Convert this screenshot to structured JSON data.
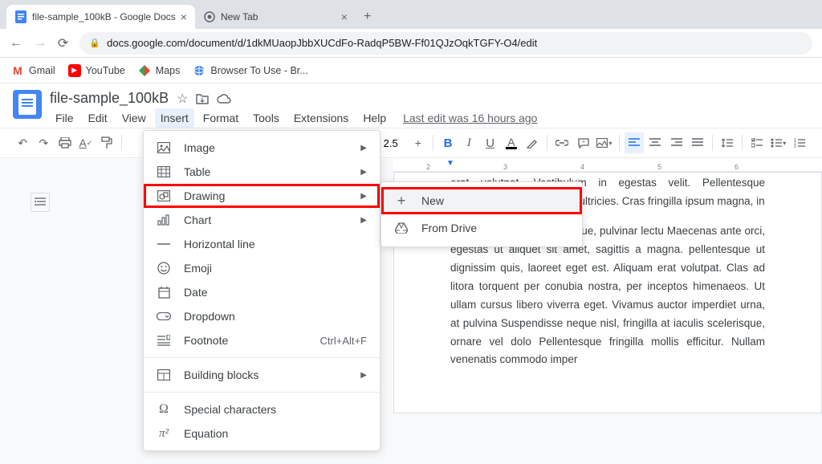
{
  "browser": {
    "tabs": [
      {
        "title": "file-sample_100kB - Google Docs",
        "active": true
      },
      {
        "title": "New Tab",
        "active": false
      }
    ],
    "url": "docs.google.com/document/d/1dkMUaopJbbXUCdFo-RadqP5BW-Ff01QJzOqkTGFY-O4/edit",
    "bookmarks": [
      {
        "label": "Gmail"
      },
      {
        "label": "YouTube"
      },
      {
        "label": "Maps"
      },
      {
        "label": "Browser To Use - Br..."
      }
    ]
  },
  "doc": {
    "title": "file-sample_100kB",
    "menus": [
      "File",
      "Edit",
      "View",
      "Insert",
      "Format",
      "Tools",
      "Extensions",
      "Help"
    ],
    "active_menu": "Insert",
    "last_edit": "Last edit was 16 hours ago",
    "font_size": "2.5"
  },
  "insert_menu": {
    "items": [
      {
        "id": "image",
        "label": "Image",
        "arrow": true,
        "icon": "image-icon"
      },
      {
        "id": "table",
        "label": "Table",
        "arrow": true,
        "icon": "table-icon"
      },
      {
        "id": "drawing",
        "label": "Drawing",
        "arrow": true,
        "icon": "drawing-icon",
        "highlight": true
      },
      {
        "id": "chart",
        "label": "Chart",
        "arrow": true,
        "icon": "chart-icon"
      },
      {
        "id": "hr",
        "label": "Horizontal line",
        "icon": "hr-icon"
      },
      {
        "id": "emoji",
        "label": "Emoji",
        "icon": "emoji-icon"
      },
      {
        "id": "date",
        "label": "Date",
        "icon": "date-icon"
      },
      {
        "id": "dropdown",
        "label": "Dropdown",
        "icon": "dropdown-icon"
      },
      {
        "id": "footnote",
        "label": "Footnote",
        "shortcut": "Ctrl+Alt+F",
        "icon": "footnote-icon"
      },
      {
        "divider": true
      },
      {
        "id": "blocks",
        "label": "Building blocks",
        "arrow": true,
        "icon": "blocks-icon"
      },
      {
        "divider": true
      },
      {
        "id": "special",
        "label": "Special characters",
        "icon": "omega-icon"
      },
      {
        "id": "equation",
        "label": "Equation",
        "icon": "pi-icon"
      }
    ]
  },
  "drawing_submenu": {
    "items": [
      {
        "id": "new",
        "label": "New",
        "icon": "plus-icon",
        "highlight": true,
        "hover": true
      },
      {
        "id": "from-drive",
        "label": "From Drive",
        "icon": "drive-icon"
      }
    ]
  },
  "ruler_ticks": [
    "2",
    "",
    "3",
    "",
    "4",
    "",
    "5",
    "",
    "6",
    ""
  ],
  "body": {
    "p1": "erat volutpat. Vestibulum in egestas velit. Pellentesque fermentum nisl v maximus ultricies. Cras fringilla ipsum magna, in",
    "p2": "mentum. In vel metus congue, pulvinar lectu Maecenas ante orci, egestas ut aliquet sit amet, sagittis a magna. pellentesque ut dignissim quis, laoreet eget est. Aliquam erat volutpat. Clas ad litora torquent per conubia nostra, per inceptos himenaeos. Ut ullam cursus libero viverra eget. Vivamus auctor imperdiet urna, at pulvina Suspendisse neque nisl, fringilla at iaculis scelerisque, ornare vel dolo Pellentesque fringilla mollis efficitur. Nullam venenatis commodo imper"
  }
}
